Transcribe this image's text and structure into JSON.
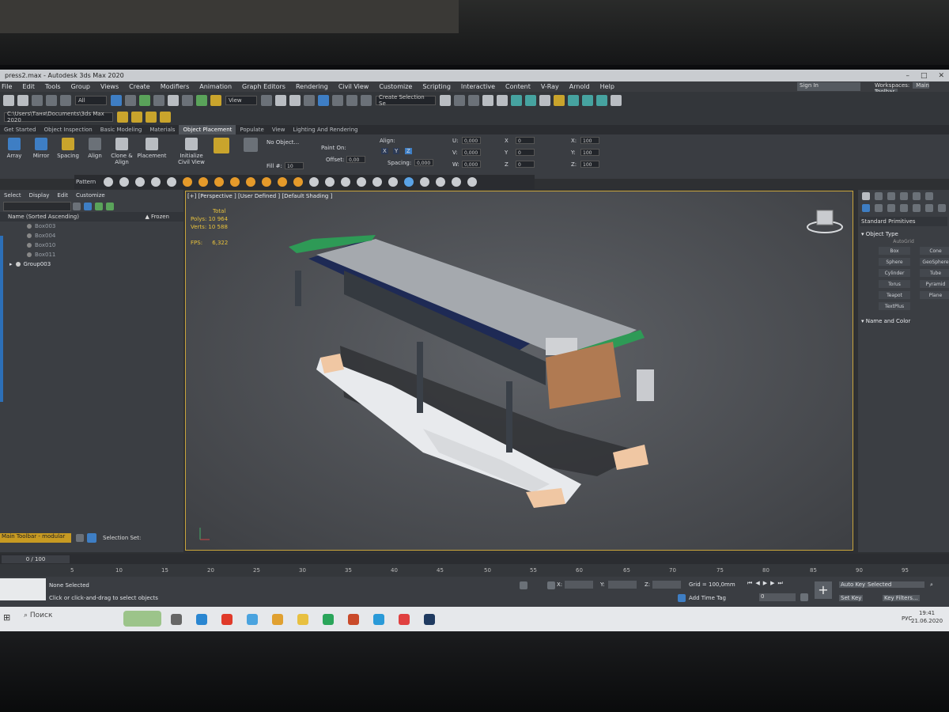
{
  "window": {
    "title": "press2.max - Autodesk 3ds Max 2020",
    "controls": [
      "–",
      "□",
      "✕"
    ]
  },
  "menu": [
    "File",
    "Edit",
    "Tools",
    "Group",
    "Views",
    "Create",
    "Modifiers",
    "Animation",
    "Graph Editors",
    "Rendering",
    "Civil View",
    "Customize",
    "Scripting",
    "Interactive",
    "Content",
    "V-Ray",
    "Arnold",
    "Help"
  ],
  "menu_right": {
    "signin": "Sign In",
    "workspaces_label": "Workspaces:",
    "workspace": "Main Toolbar"
  },
  "toolbar": {
    "filter": "All",
    "refcoord": "View",
    "selection_set": "Create Selection Se"
  },
  "path": "C:\\Users\\Таня\\Documents\\3ds Max 2020",
  "tabs": [
    "Get Started",
    "Object Inspection",
    "Basic Modeling",
    "Materials",
    "Object Placement",
    "Populate",
    "View",
    "Lighting And Rendering"
  ],
  "active_tab": "Object Placement",
  "ribbon": {
    "buttons": [
      "Array",
      "Mirror",
      "Spacing",
      "Align",
      "Clone & Align",
      "Placement",
      "Initialize Civil View"
    ],
    "no_object": "No Object...",
    "fill_label": "Fill #:",
    "fill_value": "10",
    "paint_on": "Paint On:",
    "offset_label": "Offset:",
    "offset_value": "0,00",
    "align_label": "Align:",
    "spacing_label": "Spacing:",
    "spacing_value": "0,000",
    "axes": [
      "X",
      "Y",
      "Z"
    ],
    "u": "U:",
    "u_value": "0,000",
    "v": "V:",
    "v_value": "0,000",
    "w": "W:",
    "w_value": "0,000",
    "rx": "X",
    "rx_value": "0",
    "ry": "Y",
    "ry_value": "0",
    "rz": "Z",
    "rz_value": "0",
    "sx": "X:",
    "sx_value": "100",
    "sy": "Y:",
    "sy_value": "100",
    "sz": "Z:",
    "sz_value": "100",
    "pattern": "Pattern"
  },
  "scene_explorer": {
    "menu": [
      "Select",
      "Display",
      "Edit",
      "Customize"
    ],
    "col_name": "Name (Sorted Ascending)",
    "col_frozen": "▲ Frozen",
    "items": [
      "Box003",
      "Box004",
      "Box010",
      "Box011"
    ],
    "group": "Group003"
  },
  "viewport": {
    "label": "[+] [Perspective ] [User Defined ] [Default Shading ]",
    "stats_total": "Total",
    "polys_label": "Polys:",
    "polys": "10 964",
    "verts_label": "Verts:",
    "verts": "10 588",
    "fps_label": "FPS:",
    "fps": "6,322"
  },
  "command_panel": {
    "category": "Standard Primitives",
    "object_type": "Object Type",
    "autogrid": "AutoGrid",
    "objects": [
      "Box",
      "Cone",
      "Sphere",
      "GeoSphere",
      "Cylinder",
      "Tube",
      "Torus",
      "Pyramid",
      "Teapot",
      "Plane",
      "TextPlus"
    ],
    "name_color": "Name and Color"
  },
  "bottom_left": {
    "toolbar": "Main Toolbar - modular",
    "selection_set": "Selection Set:"
  },
  "timeline": {
    "frame": "0 / 100",
    "ticks": [
      "5",
      "10",
      "15",
      "20",
      "25",
      "30",
      "35",
      "40",
      "45",
      "50",
      "55",
      "60",
      "65",
      "70",
      "75",
      "80",
      "85",
      "90",
      "95"
    ]
  },
  "status": {
    "selected": "None Selected",
    "prompt": "Click or click-and-drag to select objects",
    "x_label": "X:",
    "y_label": "Y:",
    "z_label": "Z:",
    "grid": "Grid = 100,0mm",
    "add_time_tag": "Add Time Tag",
    "auto_key": "Auto Key",
    "set_key": "Set Key",
    "selected_dd": "Selected",
    "key_filters": "Key Filters...",
    "frame_field": "0"
  },
  "taskbar": {
    "search": "Поиск",
    "lang": "РУС",
    "time": "19:41",
    "date": "21.06.2020"
  },
  "colors": {
    "accent": "#3e7ec4",
    "viewport_border": "#c8a43c",
    "stats": "#e8c23c"
  }
}
